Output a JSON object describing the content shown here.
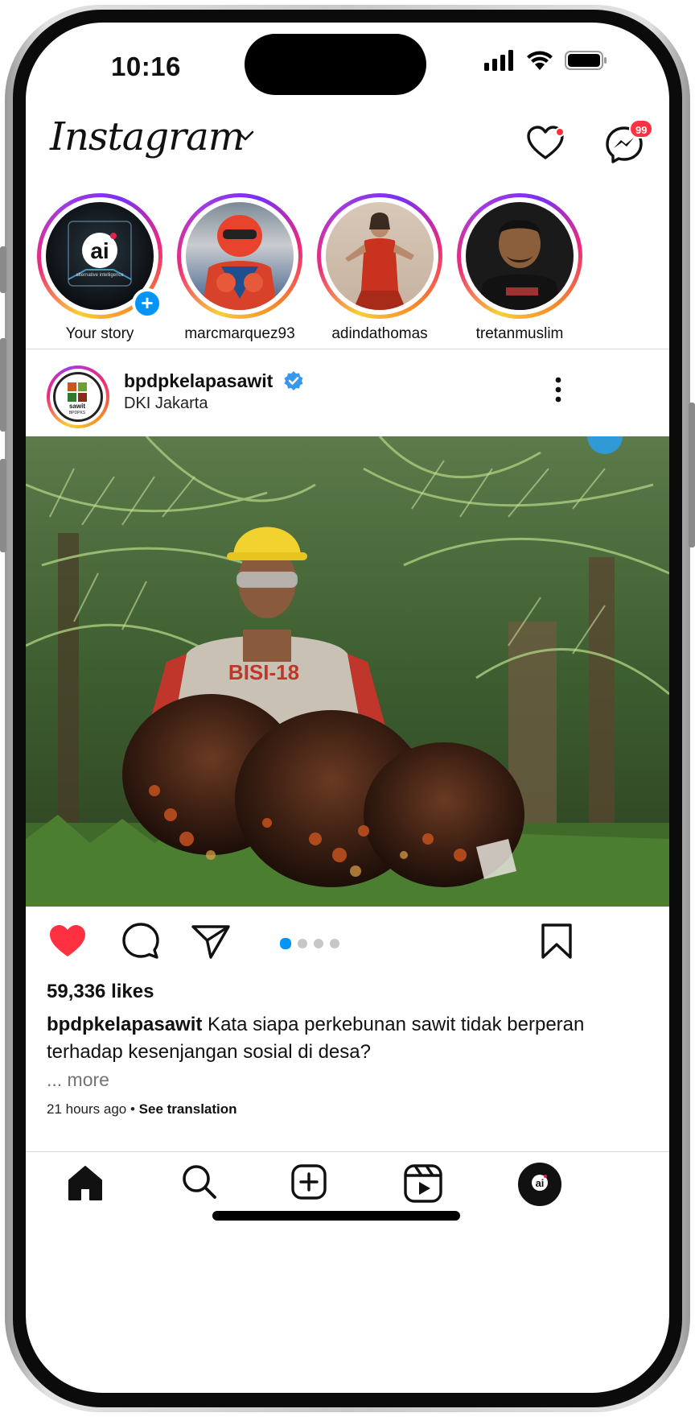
{
  "status_bar": {
    "time": "10:16"
  },
  "header": {
    "logo": "Instagram",
    "messages_badge": "99"
  },
  "stories": [
    {
      "label": "Your story"
    },
    {
      "label": "marcmarquez93"
    },
    {
      "label": "adindathomas"
    },
    {
      "label": "tretanmuslim"
    }
  ],
  "post": {
    "username": "bpdpkelapasawit",
    "location": "DKI Jakarta",
    "likes": "59,336 likes",
    "caption_user": "bpdpkelapasawit",
    "caption_text": " Kata siapa perkebunan sawit tidak berperan terhadap kesenjangan sosial di desa?",
    "more": "... more",
    "time_ago": "21 hours ago",
    "see_translation": "See translation",
    "shirt_text": "BISI-18",
    "carousel_dots": 4,
    "carousel_active": 1
  },
  "avatar_text": "ai",
  "avatar_subtext": "alternative intelligence",
  "post_avatar_text": "sawit",
  "post_avatar_subtext": "BPDPKS",
  "colors": {
    "accent": "#0095f6",
    "like": "#ff3040"
  },
  "icons": [
    "heart-icon",
    "messenger-icon",
    "comment-icon",
    "share-icon",
    "bookmark-icon",
    "home-icon",
    "search-icon",
    "create-icon",
    "reels-icon"
  ]
}
